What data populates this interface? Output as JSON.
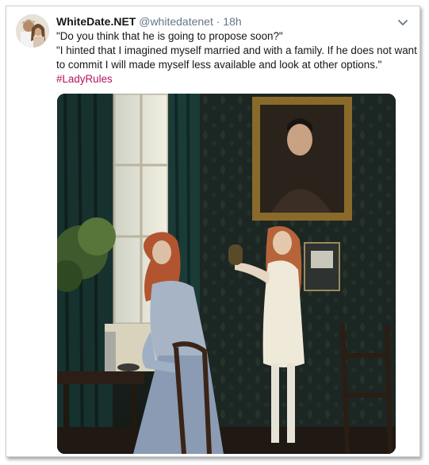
{
  "tweet": {
    "display_name": "WhiteDate.NET",
    "handle": "@whitedatenet",
    "separator": "·",
    "time": "18h",
    "lines": [
      "\"Do you think that he is going to propose soon?\"",
      "\"I hinted that I imagined myself married and with a family. If he does not want to commit I will made myself less available and look at other options.\""
    ],
    "hashtag": "#LadyRules",
    "more_icon": "chevron-down-icon",
    "media_description_icon": "photo"
  },
  "colors": {
    "name": "#14171a",
    "meta": "#657786",
    "hashtag": "#b5135a",
    "border": "#c9cfd4"
  }
}
